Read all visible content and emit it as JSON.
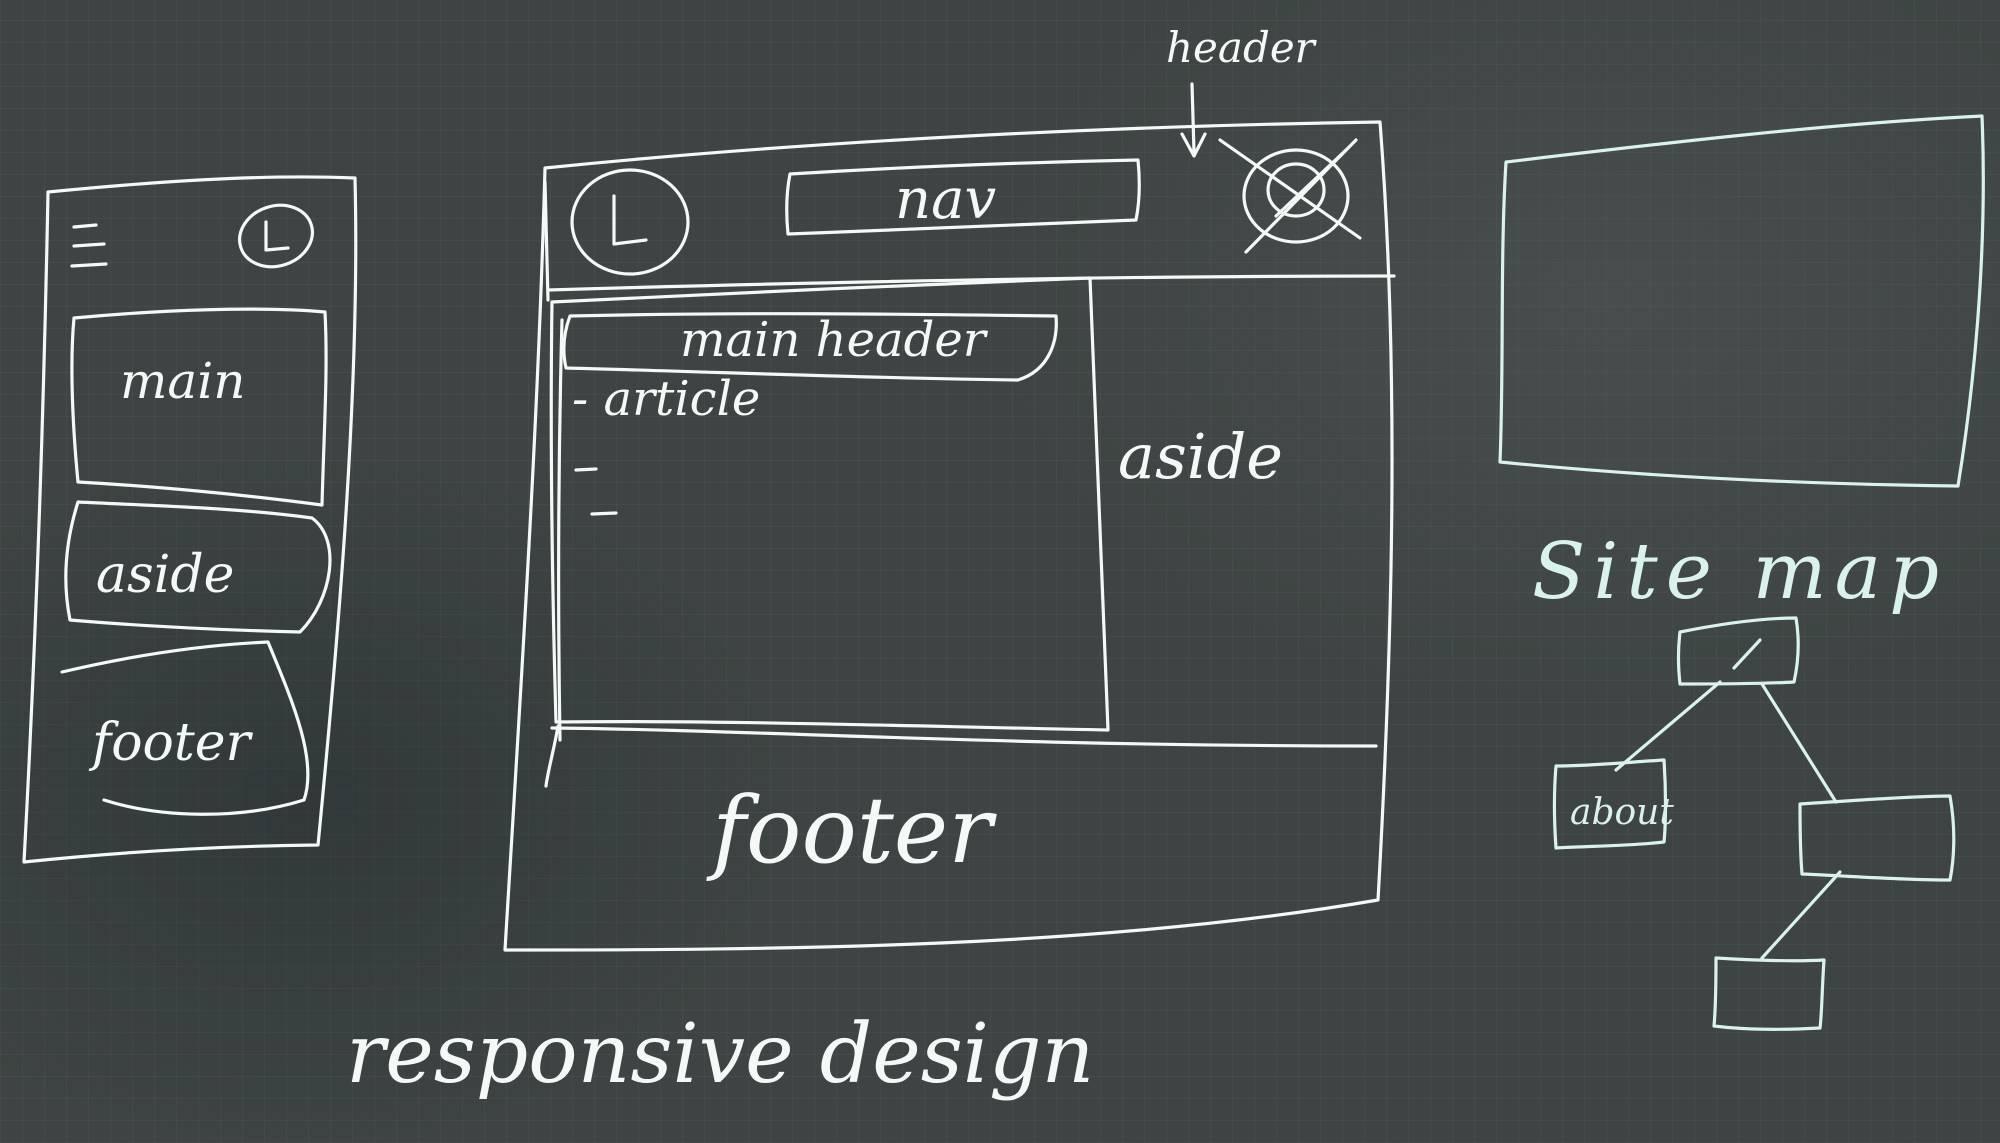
{
  "mobile": {
    "main": "main",
    "aside": "aside",
    "footer": "footer"
  },
  "desktop": {
    "header_annotation": "header",
    "nav": "nav",
    "main_header": "main header",
    "article": "- article",
    "aside": "aside",
    "footer": "footer"
  },
  "caption": "responsive design",
  "sitemap": {
    "title": "Site map",
    "about_node": "about"
  },
  "colors": {
    "board": "#3d4443",
    "ink": "#f4f8f6",
    "ink_cyan": "#d9f2ec"
  }
}
